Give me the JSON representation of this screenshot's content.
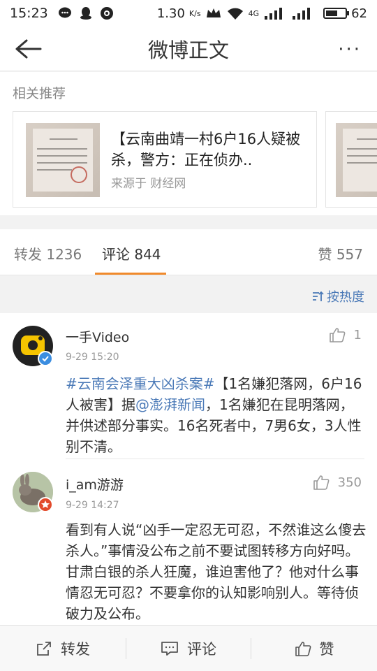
{
  "status_bar": {
    "time": "15:23",
    "speed": "1.30",
    "speed_unit": "K/s",
    "network": "4G",
    "battery": "62",
    "battery_level": 0.62
  },
  "header": {
    "title": "微博正文",
    "more": "···"
  },
  "related": {
    "label": "相关推荐",
    "card": {
      "title": "【云南曲靖一村6户16人疑被杀，警方：正在侦办..",
      "source": "来源于 财经网"
    }
  },
  "tabs": {
    "repost": "转发 1236",
    "comment": "评论 844",
    "like": "赞 557"
  },
  "sort_label": "按热度",
  "comments": [
    {
      "name": "一手Video",
      "time": "9-29 15:20",
      "likes": "1",
      "topic": "#云南会泽重大凶杀案#",
      "text_a": "【1名嫌犯落网，6户16人被害】据",
      "mention": "@澎湃新闻",
      "text_b": "，1名嫌犯在昆明落网，并供述部分事实。16名死者中，7男6女，3人性别不清。"
    },
    {
      "name": "i_am游游",
      "time": "9-29 14:27",
      "likes": "350",
      "text": "看到有人说“凶手一定忍无可忍，不然谁这么傻去杀人。”事情没公布之前不要试图转移方向好吗。甘肃白银的杀人狂魔，谁迫害他了？他对什么事情忍无可忍？不要拿你的认知影响别人。等待侦破力及公布。"
    }
  ],
  "bottom_bar": {
    "repost": "转发",
    "comment": "评论",
    "like": "赞"
  },
  "colors": {
    "accent": "#f08a2c",
    "link": "#4a79b7",
    "verified": "#3b8de0",
    "member": "#e24a2b"
  }
}
